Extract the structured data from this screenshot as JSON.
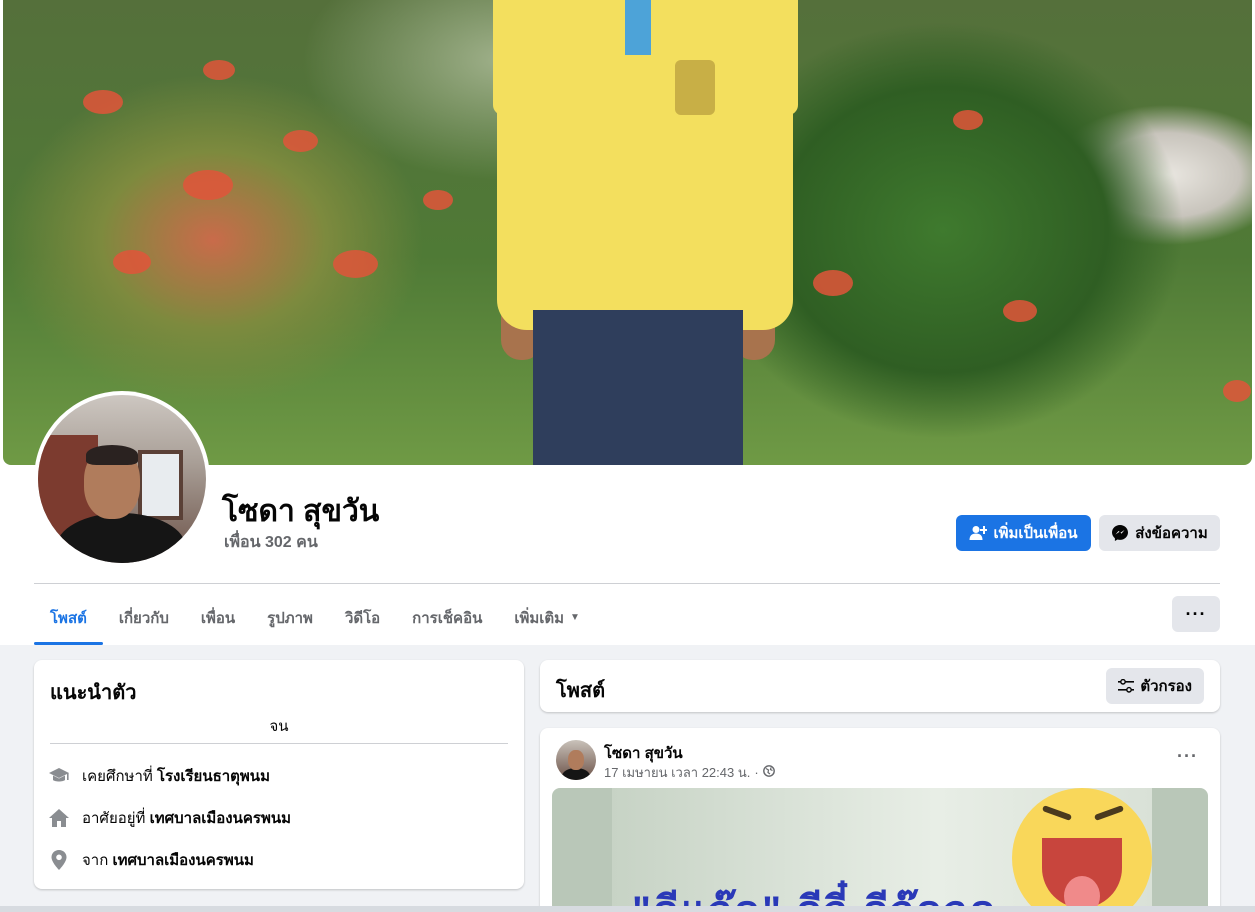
{
  "profile": {
    "name": "โซดา สุขวัน",
    "friends_count_label": "เพื่อน 302 คน"
  },
  "actions": {
    "add_friend_label": "เพิ่มเป็นเพื่อน",
    "message_label": "ส่งข้อความ",
    "more_label": "···"
  },
  "tabs": [
    {
      "label": "โพสต์",
      "active": true
    },
    {
      "label": "เกี่ยวกับ",
      "active": false
    },
    {
      "label": "เพื่อน",
      "active": false
    },
    {
      "label": "รูปภาพ",
      "active": false
    },
    {
      "label": "วิดีโอ",
      "active": false
    },
    {
      "label": "การเช็คอิน",
      "active": false
    },
    {
      "label": "เพิ่มเติม",
      "active": false
    }
  ],
  "intro": {
    "title": "แนะนำตัว",
    "bio": "จน",
    "items": [
      {
        "icon": "graduation-cap-icon",
        "prefix": "เคยศึกษาที่",
        "value": "โรงเรียนธาตุพนม"
      },
      {
        "icon": "home-icon",
        "prefix": "อาศัยอยู่ที่",
        "value": "เทศบาลเมืองนครพนม"
      },
      {
        "icon": "location-pin-icon",
        "prefix": "จาก",
        "value": "เทศบาลเมืองนครพนม"
      }
    ]
  },
  "posts": {
    "title": "โพสต์",
    "filter_label": "ตัวกรอง",
    "items": [
      {
        "author": "โซดา สุขวัน",
        "timestamp": "17 เมษายน เวลา 22:43 น.",
        "separator": "·",
        "privacy_icon": "globe-icon",
        "image_text": "\"ดีแจ๊ด\" ดีจี๋ ดีจ๊ดจด"
      }
    ]
  },
  "colors": {
    "accent": "#1b74e4",
    "button_gray": "#e4e6eb",
    "page_bg": "#f0f2f5"
  }
}
